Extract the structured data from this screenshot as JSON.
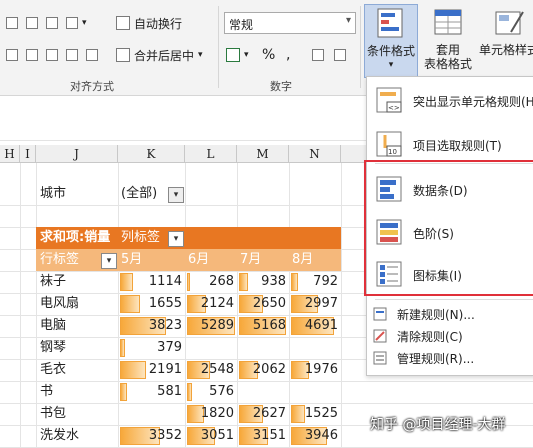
{
  "ribbon": {
    "wrap_text": "自动换行",
    "merge_center": "合并后居中",
    "number_format": "常规",
    "percent": "%",
    "comma": ",",
    "group_alignment": "对齐方式",
    "group_number": "数字",
    "cf_label": "条件格式",
    "tf_label_1": "套用",
    "tf_label_2": "表格格式",
    "cs_label": "单元格样式"
  },
  "columns": [
    "H",
    "I",
    "J",
    "K",
    "L",
    "M",
    "N"
  ],
  "pivot": {
    "filter_label": "城市",
    "filter_value": "(全部)",
    "value_header": "求和项:销量",
    "col_labels": "列标签",
    "row_labels": "行标签",
    "months": [
      "5月",
      "6月",
      "7月",
      "8月"
    ],
    "rows": [
      {
        "name": "袜子",
        "values": [
          1114,
          268,
          938,
          792
        ]
      },
      {
        "name": "电风扇",
        "values": [
          1655,
          2124,
          2650,
          2997
        ]
      },
      {
        "name": "电脑",
        "values": [
          3823,
          5289,
          5168,
          4691
        ]
      },
      {
        "name": "钢琴",
        "values": [
          379,
          null,
          null,
          null
        ]
      },
      {
        "name": "毛衣",
        "values": [
          2191,
          2548,
          2062,
          1976
        ]
      },
      {
        "name": "书",
        "values": [
          581,
          576,
          null,
          null
        ]
      },
      {
        "name": "书包",
        "values": [
          null,
          1820,
          2627,
          1525
        ]
      },
      {
        "name": "洗发水",
        "values": [
          3352,
          3051,
          3151,
          3946
        ]
      }
    ],
    "max_value": 5289
  },
  "menu": {
    "highlight_rules": "突出显示单元格规则(H)",
    "top_bottom": "项目选取规则(T)",
    "data_bars": "数据条(D)",
    "color_scales": "色阶(S)",
    "icon_sets": "图标集(I)",
    "new_rule": "新建规则(N)...",
    "clear_rules": "清除规则(C)",
    "manage_rules": "管理规则(R)..."
  },
  "watermark": "知乎 @项目经理-大群",
  "colors": {
    "pivot_header": "#e87722",
    "pivot_subheader": "#f5b87b",
    "highlight_border": "#e0303a",
    "bar": "#f7a83a"
  }
}
